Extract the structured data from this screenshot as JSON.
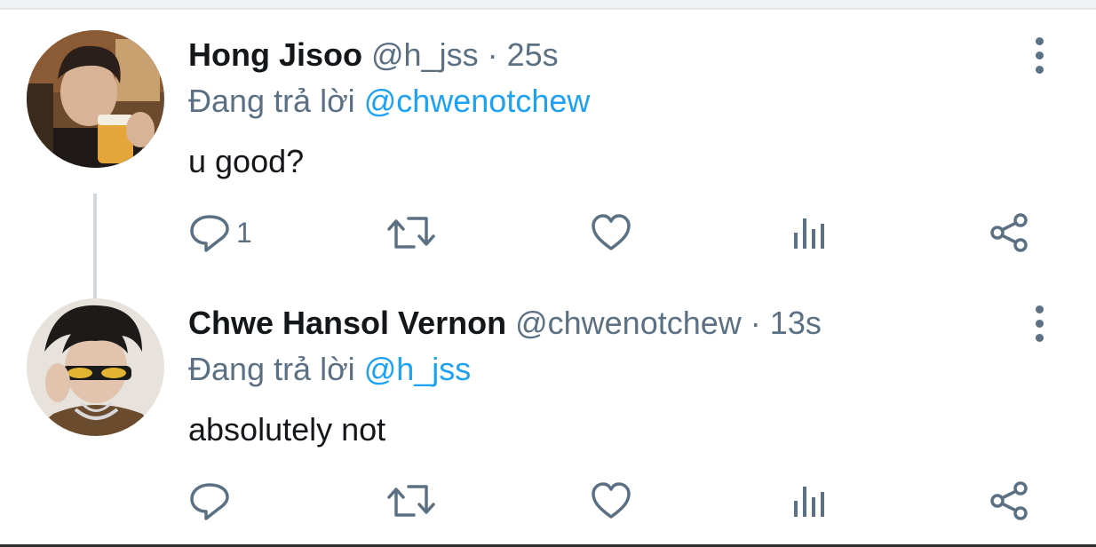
{
  "tweets": [
    {
      "name": "Hong Jisoo",
      "handle": "@h_jss",
      "separator": "·",
      "time": "25s",
      "reply_prefix": "Đang trả lời",
      "reply_to": "@chwenotchew",
      "text": "u good?",
      "reply_count": "1",
      "avatar_icon": "profile-photo-man-with-beer"
    },
    {
      "name": "Chwe Hansol Vernon",
      "handle": "@chwenotchew",
      "separator": "·",
      "time": "13s",
      "reply_prefix": "Đang trả lời",
      "reply_to": "@h_jss",
      "text": "absolutely not",
      "reply_count": "",
      "avatar_icon": "profile-photo-man-with-sunglasses"
    }
  ],
  "colors": {
    "name": "#14171a",
    "secondary": "#5b7083",
    "mention": "#1da1f2",
    "thread_line": "#cfd9de"
  },
  "icons": [
    "reply-icon",
    "retweet-icon",
    "like-icon",
    "analytics-icon",
    "share-icon",
    "more-icon"
  ]
}
